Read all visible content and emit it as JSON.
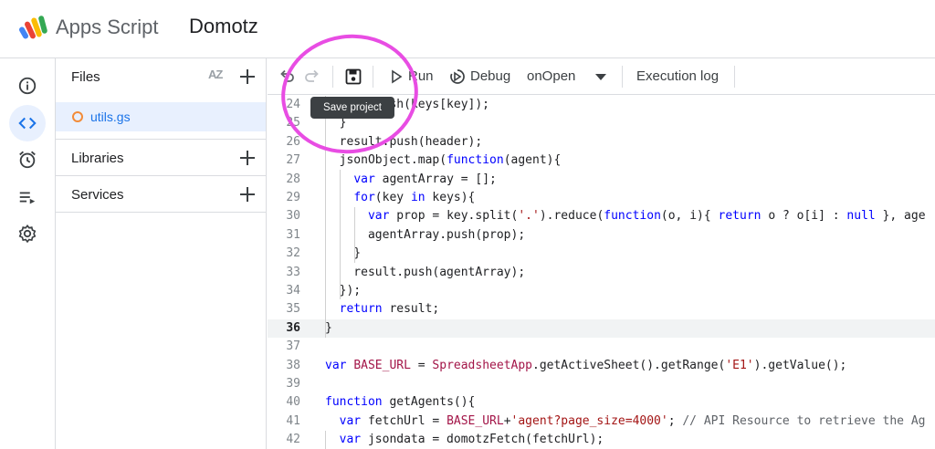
{
  "header": {
    "app_name": "Apps Script",
    "project_name": "Domotz"
  },
  "rail": {
    "items": [
      {
        "name": "overview",
        "icon": "info-icon",
        "active": false
      },
      {
        "name": "editor",
        "icon": "code-icon",
        "active": true
      },
      {
        "name": "triggers",
        "icon": "alarm-icon",
        "active": false
      },
      {
        "name": "executions",
        "icon": "list-play-icon",
        "active": false
      },
      {
        "name": "settings",
        "icon": "gear-icon",
        "active": false
      }
    ]
  },
  "files_panel": {
    "files_label": "Files",
    "sort_label": "AZ",
    "files": [
      {
        "name": "utils.gs"
      }
    ],
    "libraries_label": "Libraries",
    "services_label": "Services"
  },
  "toolbar": {
    "run_label": "Run",
    "debug_label": "Debug",
    "function_select": "onOpen",
    "execution_log_label": "Execution log",
    "save_tooltip": "Save project"
  },
  "editor": {
    "current_line": "36",
    "lines": [
      {
        "n": "24",
        "text": "      .push(keys[key]);"
      },
      {
        "n": "25",
        "text": "  }"
      },
      {
        "n": "26",
        "text": "  result.push(header);"
      },
      {
        "n": "27",
        "text": "  jsonObject.map(function(agent){"
      },
      {
        "n": "28",
        "text": "    var agentArray = [];"
      },
      {
        "n": "29",
        "text": "    for(key in keys){"
      },
      {
        "n": "30",
        "text": "      var prop = key.split('.').reduce(function(o, i){ return o ? o[i] : null }, age"
      },
      {
        "n": "31",
        "text": "      agentArray.push(prop);"
      },
      {
        "n": "32",
        "text": "    }"
      },
      {
        "n": "33",
        "text": "    result.push(agentArray);"
      },
      {
        "n": "34",
        "text": "  });"
      },
      {
        "n": "35",
        "text": "  return result;"
      },
      {
        "n": "36",
        "text": "}"
      },
      {
        "n": "37",
        "text": ""
      },
      {
        "n": "38",
        "text": "var BASE_URL = SpreadsheetApp.getActiveSheet().getRange('E1').getValue();"
      },
      {
        "n": "39",
        "text": ""
      },
      {
        "n": "40",
        "text": "function getAgents(){"
      },
      {
        "n": "41",
        "text": "  var fetchUrl = BASE_URL+'agent?page_size=4000'; // API Resource to retrieve the Ag"
      },
      {
        "n": "42",
        "text": "  var jsondata = domotzFetch(fetchUrl);"
      }
    ]
  },
  "colors": {
    "accent": "#1a73e8",
    "active_bg": "#e8f0fe",
    "file_dot": "#f28b38",
    "annotation": "#e84de3",
    "keyword": "#0000ff",
    "string": "#a31515"
  }
}
